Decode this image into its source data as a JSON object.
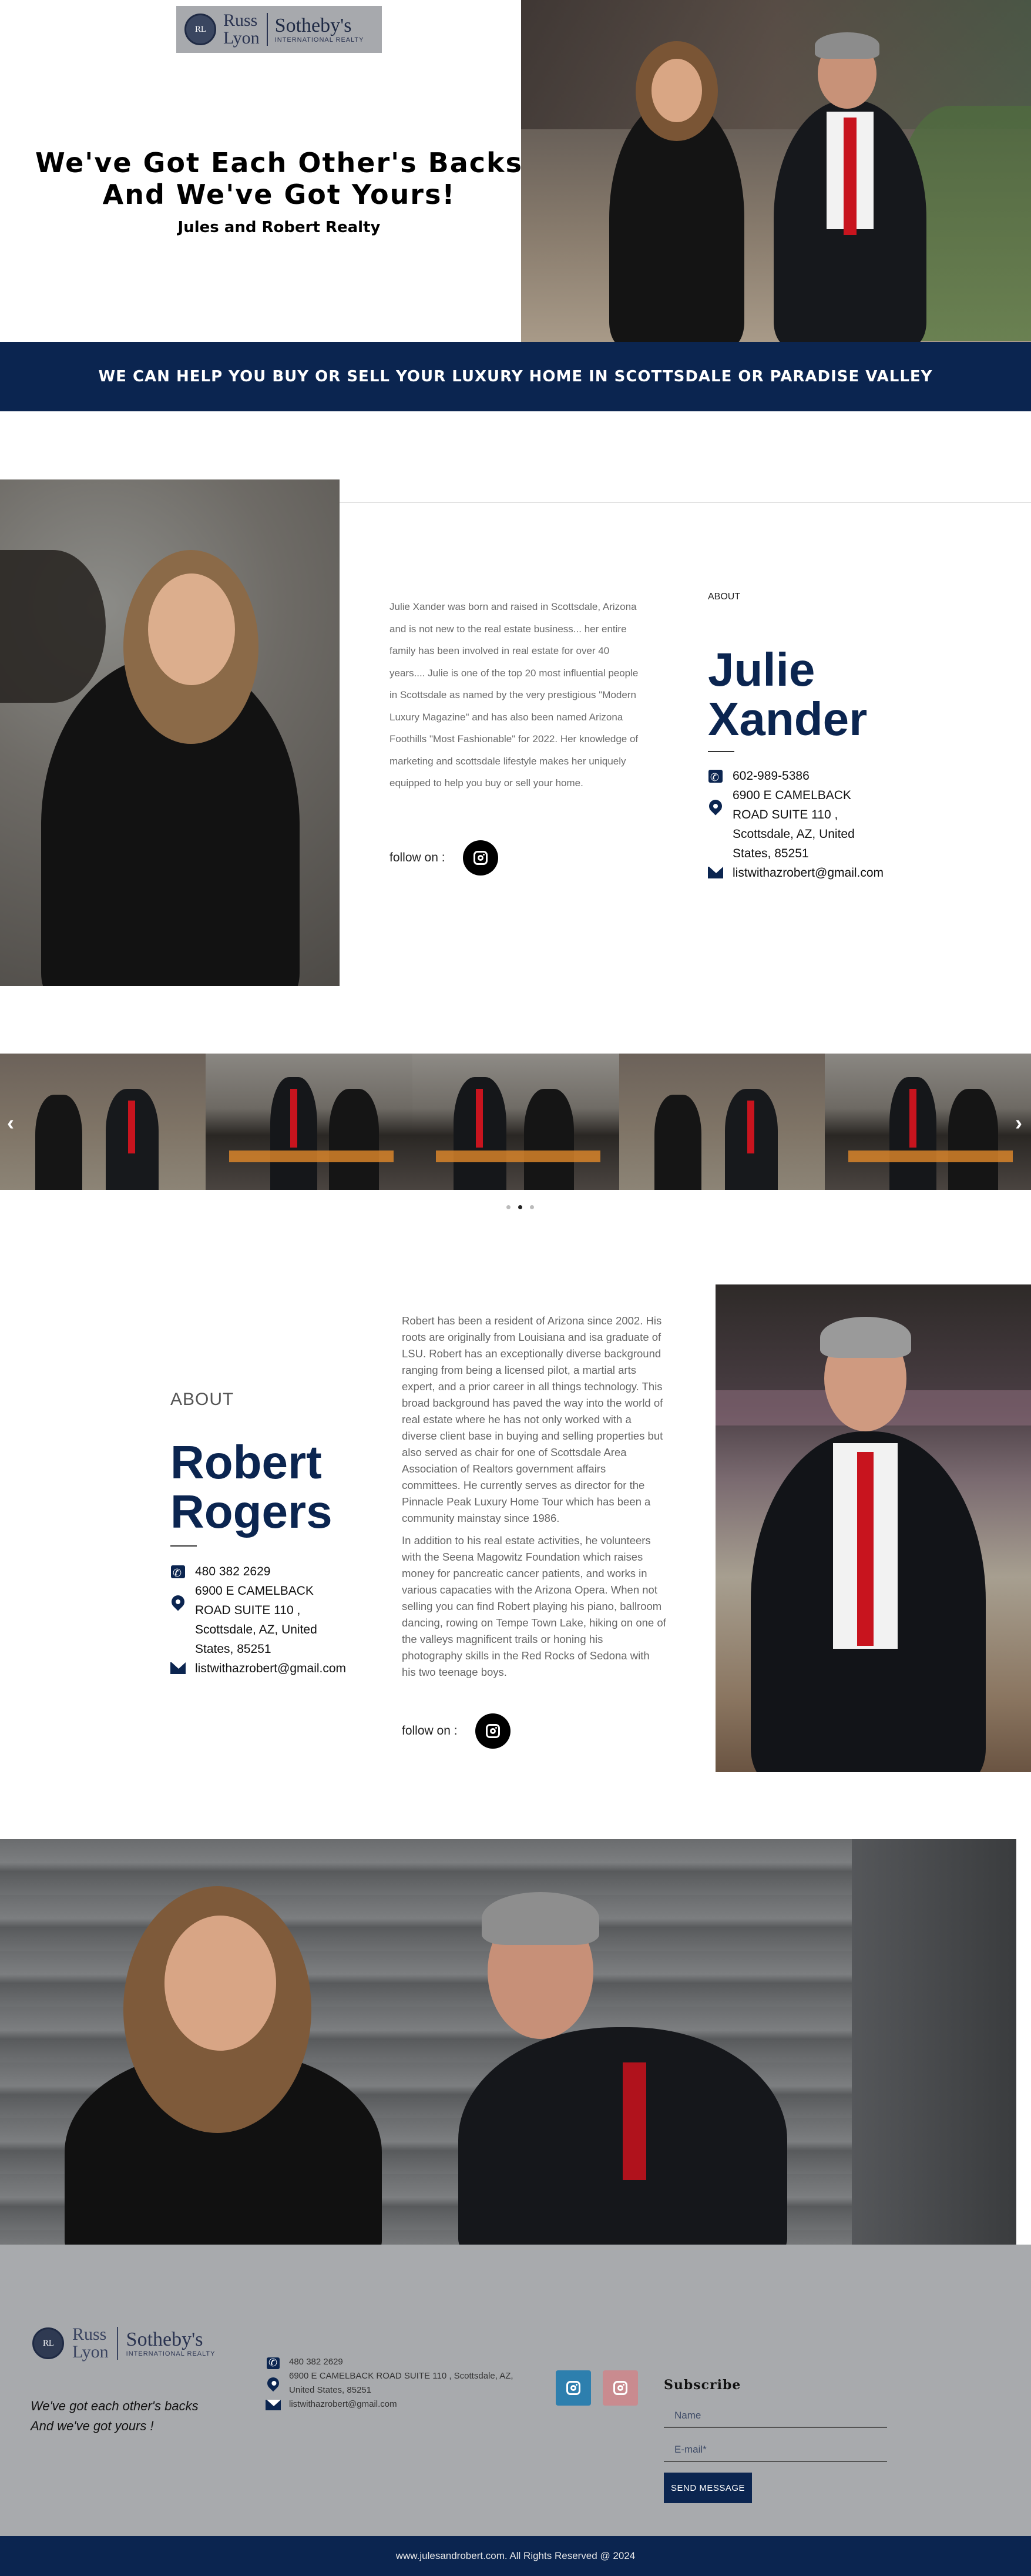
{
  "brand": {
    "logo_line1": "Russ",
    "logo_line2": "Lyon",
    "logo_name": "Sotheby's",
    "logo_sub": "INTERNATIONAL REALTY"
  },
  "hero": {
    "title_line1": "We've Got Each Other's Backs",
    "title_line2": "And We've Got Yours!",
    "subtitle": "Jules and Robert Realty"
  },
  "banner": {
    "text": "WE CAN HELP YOU BUY OR SELL YOUR LUXURY HOME IN SCOTTSDALE OR PARADISE VALLEY"
  },
  "julie": {
    "about": "ABOUT",
    "first_name": "Julie",
    "last_name": "Xander",
    "bio": "Julie Xander was born and raised in Scottsdale, Arizona and is not new to the real estate business... her entire family has been involved in real estate for over 40 years.... Julie is one of the top 20 most influential people in Scottsdale as named by the very prestigious \"Modern Luxury Magazine\" and has also been named Arizona Foothills \"Most Fashionable\" for 2022. Her knowledge of marketing and scottsdale lifestyle makes her uniquely equipped to help you buy or sell your home.",
    "follow_label": "follow on :",
    "phone": "602-989-5386",
    "address_line1": "6900 E CAMELBACK",
    "address_line2": "ROAD SUITE 110 ,",
    "address_line3": "Scottsdale, AZ, United",
    "address_line4": "States, 85251",
    "email": "listwithazrobert@gmail.com"
  },
  "carousel": {
    "prev": "‹",
    "next": "›",
    "slide_count": 5,
    "active_dot": 1
  },
  "robert": {
    "about": "ABOUT",
    "first_name": "Robert",
    "last_name": "Rogers",
    "bio_p1": "Robert has been a resident of Arizona since 2002. His roots are originally from Louisiana and isa graduate of LSU. Robert has an exceptionally diverse background ranging from being a licensed pilot, a martial arts expert, and a prior career in all things technology. This broad background has paved the way into the world of real estate where he has not only worked with a diverse client base in buying and selling properties but also served as chair for one of Scottsdale Area Association of Realtors government affairs committees. He currently serves as director for the Pinnacle Peak Luxury Home Tour which has been a community mainstay since 1986.",
    "bio_p2": "In addition to his real estate activities, he volunteers with the Seena Magowitz Foundation which raises money for pancreatic cancer patients, and works in various capacaties with the Arizona Opera. When not selling you can find Robert playing his piano, ballroom dancing, rowing on Tempe Town Lake, hiking on one of the valleys magnificent trails or honing his photography skills in the Red Rocks of Sedona with his two teenage boys.",
    "follow_label": "follow on :",
    "phone": "480 382 2629",
    "address_line1": "6900 E CAMELBACK",
    "address_line2": "ROAD SUITE 110 ,",
    "address_line3": "Scottsdale, AZ, United",
    "address_line4": "States, 85251",
    "email": "listwithazrobert@gmail.com"
  },
  "footer": {
    "tagline_line1": "We've got each other's backs",
    "tagline_line2": "And we've got yours !",
    "phone": "480 382 2629",
    "address_line1": "6900 E CAMELBACK ROAD SUITE 110 , Scottsdale, AZ,",
    "address_line2": "United States, 85251",
    "email": "listwithazrobert@gmail.com",
    "subscribe_title": "Subscribe",
    "name_placeholder": "Name",
    "email_placeholder": "E-mail*",
    "send_label": "SEND MESSAGE",
    "copyright": "www.julesandrobert.com. All Rights Reserved @ 2024"
  },
  "colors": {
    "navy": "#0b2550",
    "footer_gray": "#a8aaad",
    "instagram_blue": "#2d7fae",
    "instagram_pink": "#c98b8f"
  },
  "icons": [
    "phone-icon",
    "map-pin-icon",
    "mail-icon",
    "instagram-icon",
    "chevron-left-icon",
    "chevron-right-icon"
  ]
}
